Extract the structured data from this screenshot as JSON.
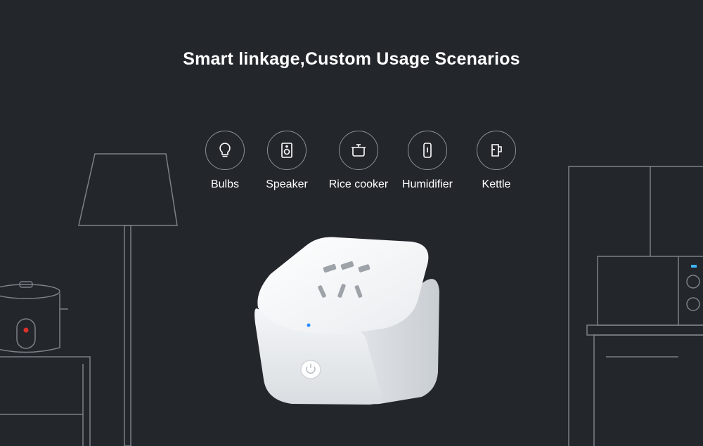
{
  "headline": "Smart linkage,Custom Usage Scenarios",
  "scenarios": [
    {
      "label": "Bulbs",
      "icon": "bulb-icon"
    },
    {
      "label": "Speaker",
      "icon": "speaker-icon"
    },
    {
      "label": "Rice cooker",
      "icon": "rice-cooker-icon"
    },
    {
      "label": "Humidifier",
      "icon": "humidifier-icon"
    },
    {
      "label": "Kettle",
      "icon": "kettle-icon"
    }
  ],
  "colors": {
    "background": "#23262b",
    "line": "#7d8188",
    "indicator_blue": "#2a8cff",
    "cooker_red": "#e0302a"
  }
}
